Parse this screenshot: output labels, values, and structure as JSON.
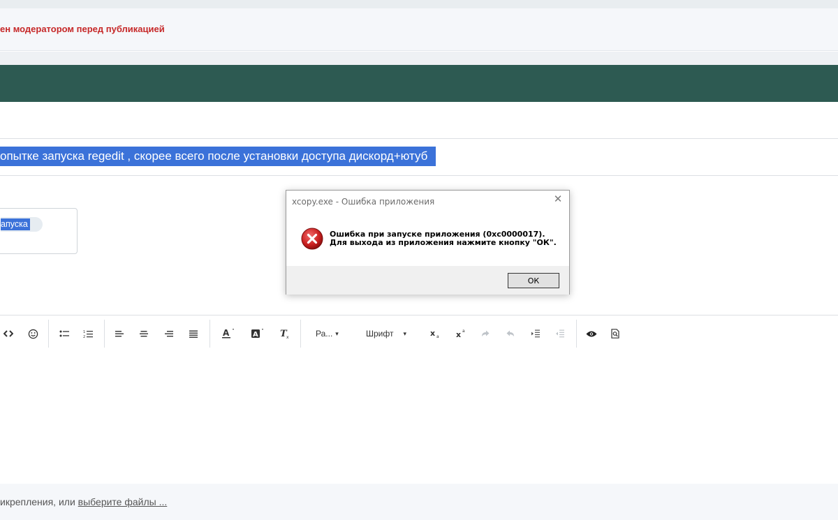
{
  "notice": {
    "text": "ен модератором перед публикацией"
  },
  "topic": {
    "title_selected": "опытке запуска regedit , скорее всего после установки доступа дискорд+ютуб"
  },
  "tags": {
    "tag_selected": "апуска"
  },
  "toolbar": {
    "paragraph_label": "Ра...",
    "font_label": "Шрифт",
    "caret": "▾",
    "icons": [
      "code-icon",
      "emoji-icon",
      "bullet-list-icon",
      "numbered-list-icon",
      "align-left-icon",
      "align-center-icon",
      "align-right-icon",
      "align-justify-icon",
      "text-color-icon",
      "background-color-icon",
      "clear-format-icon",
      "subscript-icon",
      "superscript-icon",
      "redo-icon",
      "undo-icon",
      "indent-icon",
      "outdent-icon",
      "preview-icon",
      "search-doc-icon"
    ]
  },
  "footer": {
    "text_prefix": "икрепления, или ",
    "link": "выберите файлы ..."
  },
  "dialog": {
    "title": "xcopy.exe - Ошибка приложения",
    "close_glyph": "✕",
    "message": "Ошибка при запуске приложения (0xc0000017). Для выхода из приложения нажмите кнопку \"ОК\".",
    "ok_label": "ОК",
    "icon": "error-icon"
  },
  "colors": {
    "header_green": "#2d5a52",
    "selection_blue": "#3b72d9",
    "notice_red": "#c62828"
  }
}
